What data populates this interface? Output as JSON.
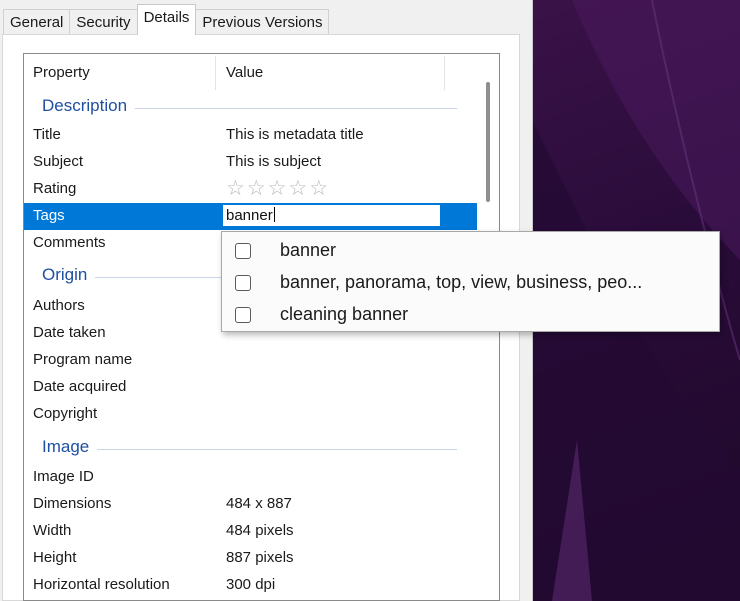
{
  "tabs": [
    {
      "label": "General"
    },
    {
      "label": "Security"
    },
    {
      "label": "Details"
    },
    {
      "label": "Previous Versions"
    }
  ],
  "columns": {
    "property": "Property",
    "value": "Value"
  },
  "groups": {
    "description": "Description",
    "origin": "Origin",
    "image": "Image"
  },
  "rows": {
    "title": {
      "prop": "Title",
      "val": "This is metadata title"
    },
    "subject": {
      "prop": "Subject",
      "val": "This is subject"
    },
    "rating": {
      "prop": "Rating",
      "stars_filled": 0,
      "stars_total": 5
    },
    "tags": {
      "prop": "Tags",
      "input_value": "banner"
    },
    "comments": {
      "prop": "Comments"
    },
    "authors": {
      "prop": "Authors"
    },
    "date_taken": {
      "prop": "Date taken"
    },
    "program_name": {
      "prop": "Program name"
    },
    "date_acquired": {
      "prop": "Date acquired"
    },
    "copyright": {
      "prop": "Copyright"
    },
    "image_id": {
      "prop": "Image ID"
    },
    "dimensions": {
      "prop": "Dimensions",
      "val": "484 x 887"
    },
    "width": {
      "prop": "Width",
      "val": "484 pixels"
    },
    "height": {
      "prop": "Height",
      "val": "887 pixels"
    },
    "hres": {
      "prop": "Horizontal resolution",
      "val": "300 dpi"
    }
  },
  "suggestions": [
    {
      "label": "banner",
      "checked": false
    },
    {
      "label": "banner, panorama, top, view, business, peo...",
      "checked": false
    },
    {
      "label": "cleaning banner",
      "checked": false
    }
  ],
  "colors": {
    "selection": "#0078d7",
    "group_heading": "#1f4fa0",
    "wallpaper": "#2a0c3a"
  }
}
